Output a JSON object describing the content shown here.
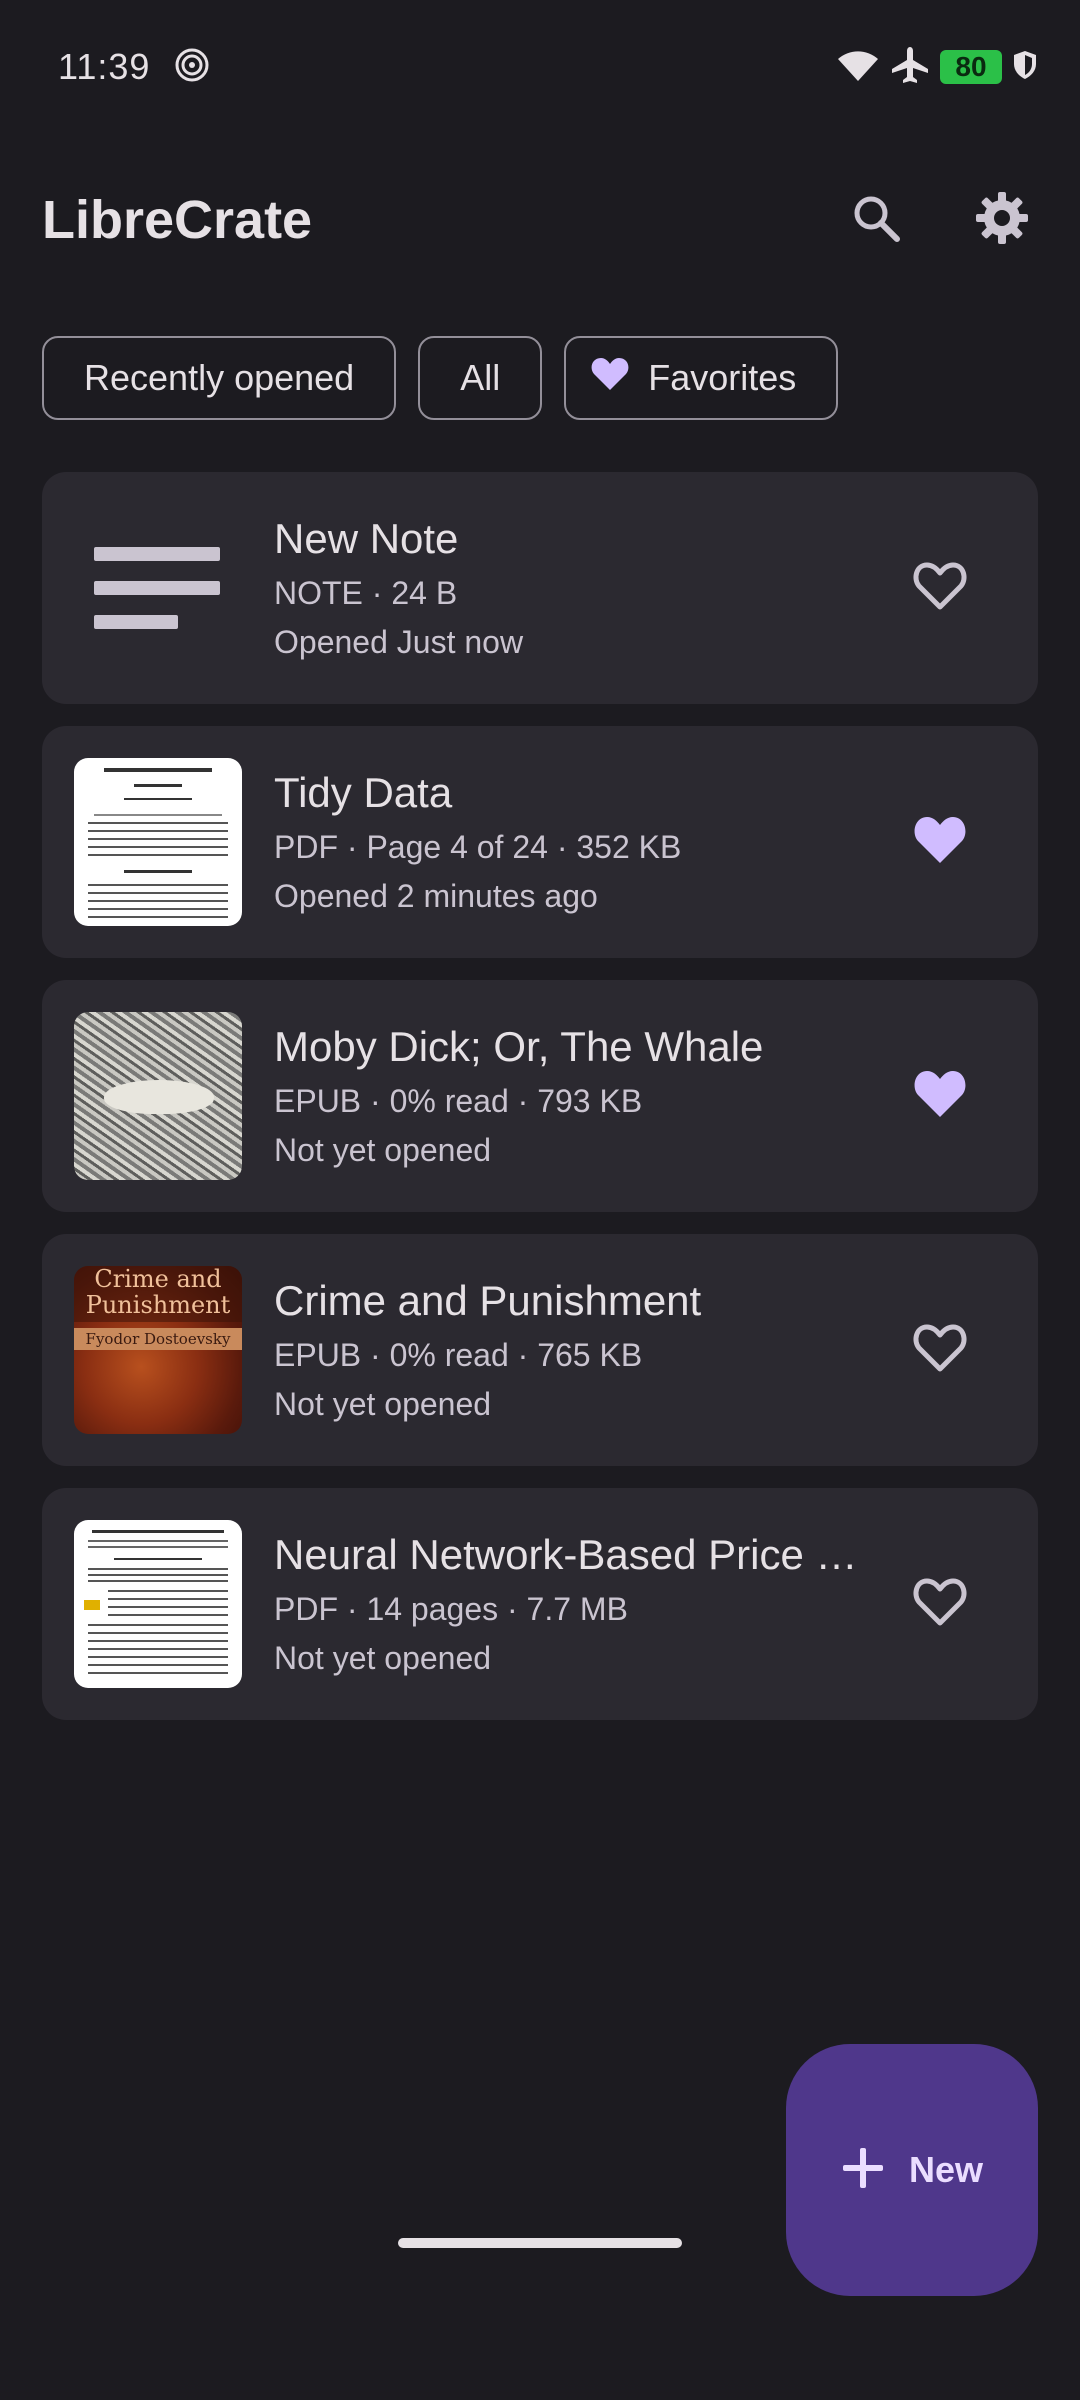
{
  "status_bar": {
    "time": "11:39",
    "battery": "80",
    "icons": [
      "focus-mode-icon",
      "wifi-icon",
      "airplane-icon",
      "battery-icon",
      "shield-icon"
    ]
  },
  "app_bar": {
    "title": "LibreCrate",
    "actions": [
      "search-icon",
      "settings-icon"
    ]
  },
  "filters": {
    "recently_opened": "Recently opened",
    "all": "All",
    "favorites": "Favorites"
  },
  "items": [
    {
      "title": "New Note",
      "meta": "NOTE · 24 B",
      "opened": "Opened Just now",
      "favorite": false,
      "thumb": "note-icon"
    },
    {
      "title": "Tidy Data",
      "meta": "PDF · Page 4 of 24 · 352 KB",
      "opened": "Opened 2 minutes ago",
      "favorite": true,
      "thumb": "pdf-thumbnail"
    },
    {
      "title": "Moby Dick; Or, The Whale",
      "meta": "EPUB · 0% read · 793 KB",
      "opened": "Not yet opened",
      "favorite": true,
      "thumb": "epub-cover"
    },
    {
      "title": "Crime and Punishment",
      "meta": "EPUB · 0% read · 765 KB",
      "opened": "Not yet opened",
      "favorite": false,
      "thumb": "epub-cover",
      "cover_title": "Crime and Punishment",
      "cover_author": "Fyodor Dostoevsky"
    },
    {
      "title": "Neural Network-Based Price …",
      "meta": "PDF · 14 pages · 7.7 MB",
      "opened": "Not yet opened",
      "favorite": false,
      "thumb": "pdf-thumbnail"
    }
  ],
  "fab": {
    "label": "New",
    "icon": "plus-icon"
  },
  "colors": {
    "background": "#1c1b20",
    "card": "#2b2930",
    "accent": "#d0bcff",
    "fab": "#4f378b",
    "outline": "#938f99"
  }
}
